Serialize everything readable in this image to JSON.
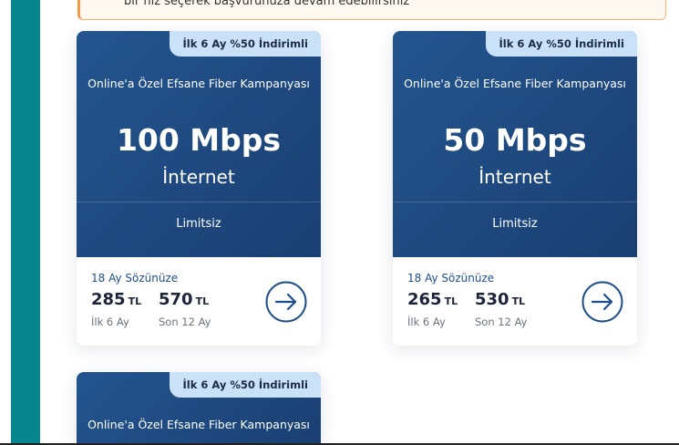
{
  "notice": {
    "text": "bir hız seçerek başvurunuza devam edebilirsiniz"
  },
  "cards": [
    {
      "badge": "İlk 6 Ay %50 İndirimli",
      "campaign": "Online'a Özel Efsane Fiber Kampanyası",
      "speed": "100 Mbps",
      "service": "İnternet",
      "quota": "Limitsiz",
      "contract": "18 Ay Sözünüze",
      "price1": "285",
      "price1_currency": "TL",
      "price1_period": "İlk 6 Ay",
      "price2": "570",
      "price2_currency": "TL",
      "price2_period": "Son 12 Ay"
    },
    {
      "badge": "İlk 6 Ay %50 İndirimli",
      "campaign": "Online'a Özel Efsane Fiber Kampanyası",
      "speed": "50 Mbps",
      "service": "İnternet",
      "quota": "Limitsiz",
      "contract": "18 Ay Sözünüze",
      "price1": "265",
      "price1_currency": "TL",
      "price1_period": "İlk 6 Ay",
      "price2": "530",
      "price2_currency": "TL",
      "price2_period": "Son 12 Ay"
    },
    {
      "badge": "İlk 6 Ay %50 İndirimli",
      "campaign": "Online'a Özel Efsane Fiber Kampanyası"
    }
  ],
  "icons": {
    "next": "arrow-right-circle-icon"
  },
  "colors": {
    "card_top": "#1f4b82",
    "badge_bg": "#c9e2f7",
    "accent": "#1e4e8c",
    "sidebar": "#08868f",
    "notice_border": "#f4b37a"
  }
}
